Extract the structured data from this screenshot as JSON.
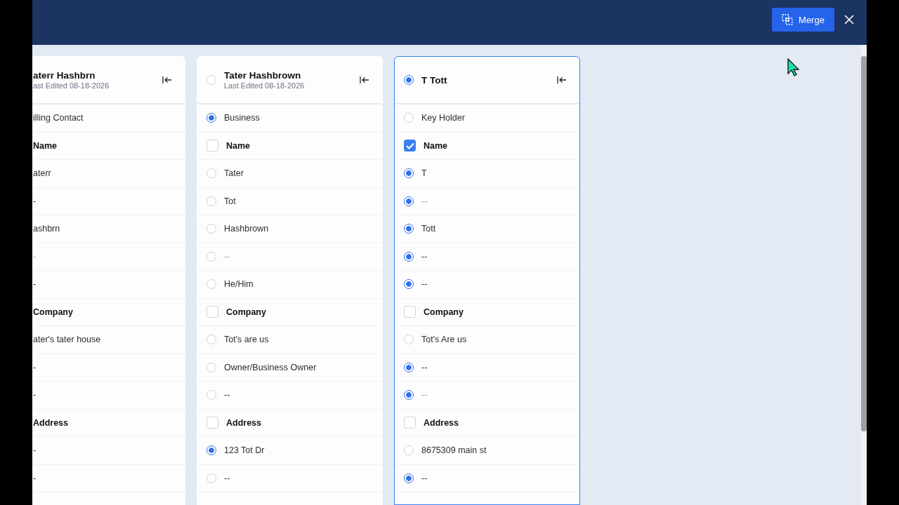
{
  "header": {
    "merge_button": "Merge"
  },
  "columns": [
    {
      "title": "aterr Hashbrn",
      "subtitle": "ast Edited 08-18-2026",
      "highlighted": false,
      "rows": [
        {
          "kind": "text",
          "label": "illing Contact",
          "muted": false
        },
        {
          "kind": "heading",
          "label": "Name"
        },
        {
          "kind": "text",
          "label": "aterr",
          "muted": false
        },
        {
          "kind": "text",
          "label": "-",
          "muted": false
        },
        {
          "kind": "text",
          "label": "ashbrn",
          "muted": false
        },
        {
          "kind": "text",
          "label": "-",
          "muted": true
        },
        {
          "kind": "text",
          "label": "-",
          "muted": false
        },
        {
          "kind": "heading",
          "label": "Company"
        },
        {
          "kind": "text",
          "label": "ater's tater house",
          "muted": false
        },
        {
          "kind": "text",
          "label": "-",
          "muted": false
        },
        {
          "kind": "text",
          "label": "-",
          "muted": false
        },
        {
          "kind": "heading",
          "label": "Address"
        },
        {
          "kind": "text",
          "label": "-",
          "muted": false
        },
        {
          "kind": "text",
          "label": "-",
          "muted": false
        }
      ]
    },
    {
      "title": "Tater Hashbrown",
      "subtitle": "Last Edited 08-18-2026",
      "selected": false,
      "highlighted": false,
      "rows": [
        {
          "kind": "option",
          "label": "Business",
          "selected": true,
          "muted": false
        },
        {
          "kind": "section",
          "label": "Name",
          "checked": false
        },
        {
          "kind": "option",
          "label": "Tater",
          "selected": false,
          "muted": false
        },
        {
          "kind": "option",
          "label": "Tot",
          "selected": false,
          "muted": false
        },
        {
          "kind": "option",
          "label": "Hashbrown",
          "selected": false,
          "muted": false
        },
        {
          "kind": "option",
          "label": "--",
          "selected": false,
          "muted": true
        },
        {
          "kind": "option",
          "label": "He/Him",
          "selected": false,
          "muted": false
        },
        {
          "kind": "section",
          "label": "Company",
          "checked": false
        },
        {
          "kind": "option",
          "label": "Tot's are us",
          "selected": false,
          "muted": false
        },
        {
          "kind": "option",
          "label": "Owner/Business Owner",
          "selected": false,
          "muted": false
        },
        {
          "kind": "option",
          "label": "--",
          "selected": false,
          "muted": false
        },
        {
          "kind": "section",
          "label": "Address",
          "checked": false
        },
        {
          "kind": "option",
          "label": "123 Tot Dr",
          "selected": true,
          "muted": false
        },
        {
          "kind": "option",
          "label": "--",
          "selected": false,
          "muted": false
        }
      ]
    },
    {
      "title": "T Tott",
      "selected": true,
      "highlighted": true,
      "rows": [
        {
          "kind": "option",
          "label": "Key Holder",
          "selected": false,
          "muted": false
        },
        {
          "kind": "section",
          "label": "Name",
          "checked": true
        },
        {
          "kind": "option",
          "label": "T",
          "selected": true,
          "muted": false
        },
        {
          "kind": "option",
          "label": "--",
          "selected": true,
          "muted": true
        },
        {
          "kind": "option",
          "label": "Tott",
          "selected": true,
          "muted": false
        },
        {
          "kind": "option",
          "label": "--",
          "selected": true,
          "muted": false
        },
        {
          "kind": "option",
          "label": "--",
          "selected": true,
          "muted": false
        },
        {
          "kind": "section",
          "label": "Company",
          "checked": false
        },
        {
          "kind": "option",
          "label": "Tot's Are us",
          "selected": false,
          "muted": false
        },
        {
          "kind": "option",
          "label": "--",
          "selected": true,
          "muted": false
        },
        {
          "kind": "option",
          "label": "--",
          "selected": true,
          "muted": true
        },
        {
          "kind": "section",
          "label": "Address",
          "checked": false
        },
        {
          "kind": "option",
          "label": "8675309 main st",
          "selected": false,
          "muted": false
        },
        {
          "kind": "option",
          "label": "--",
          "selected": true,
          "muted": false
        }
      ]
    }
  ]
}
